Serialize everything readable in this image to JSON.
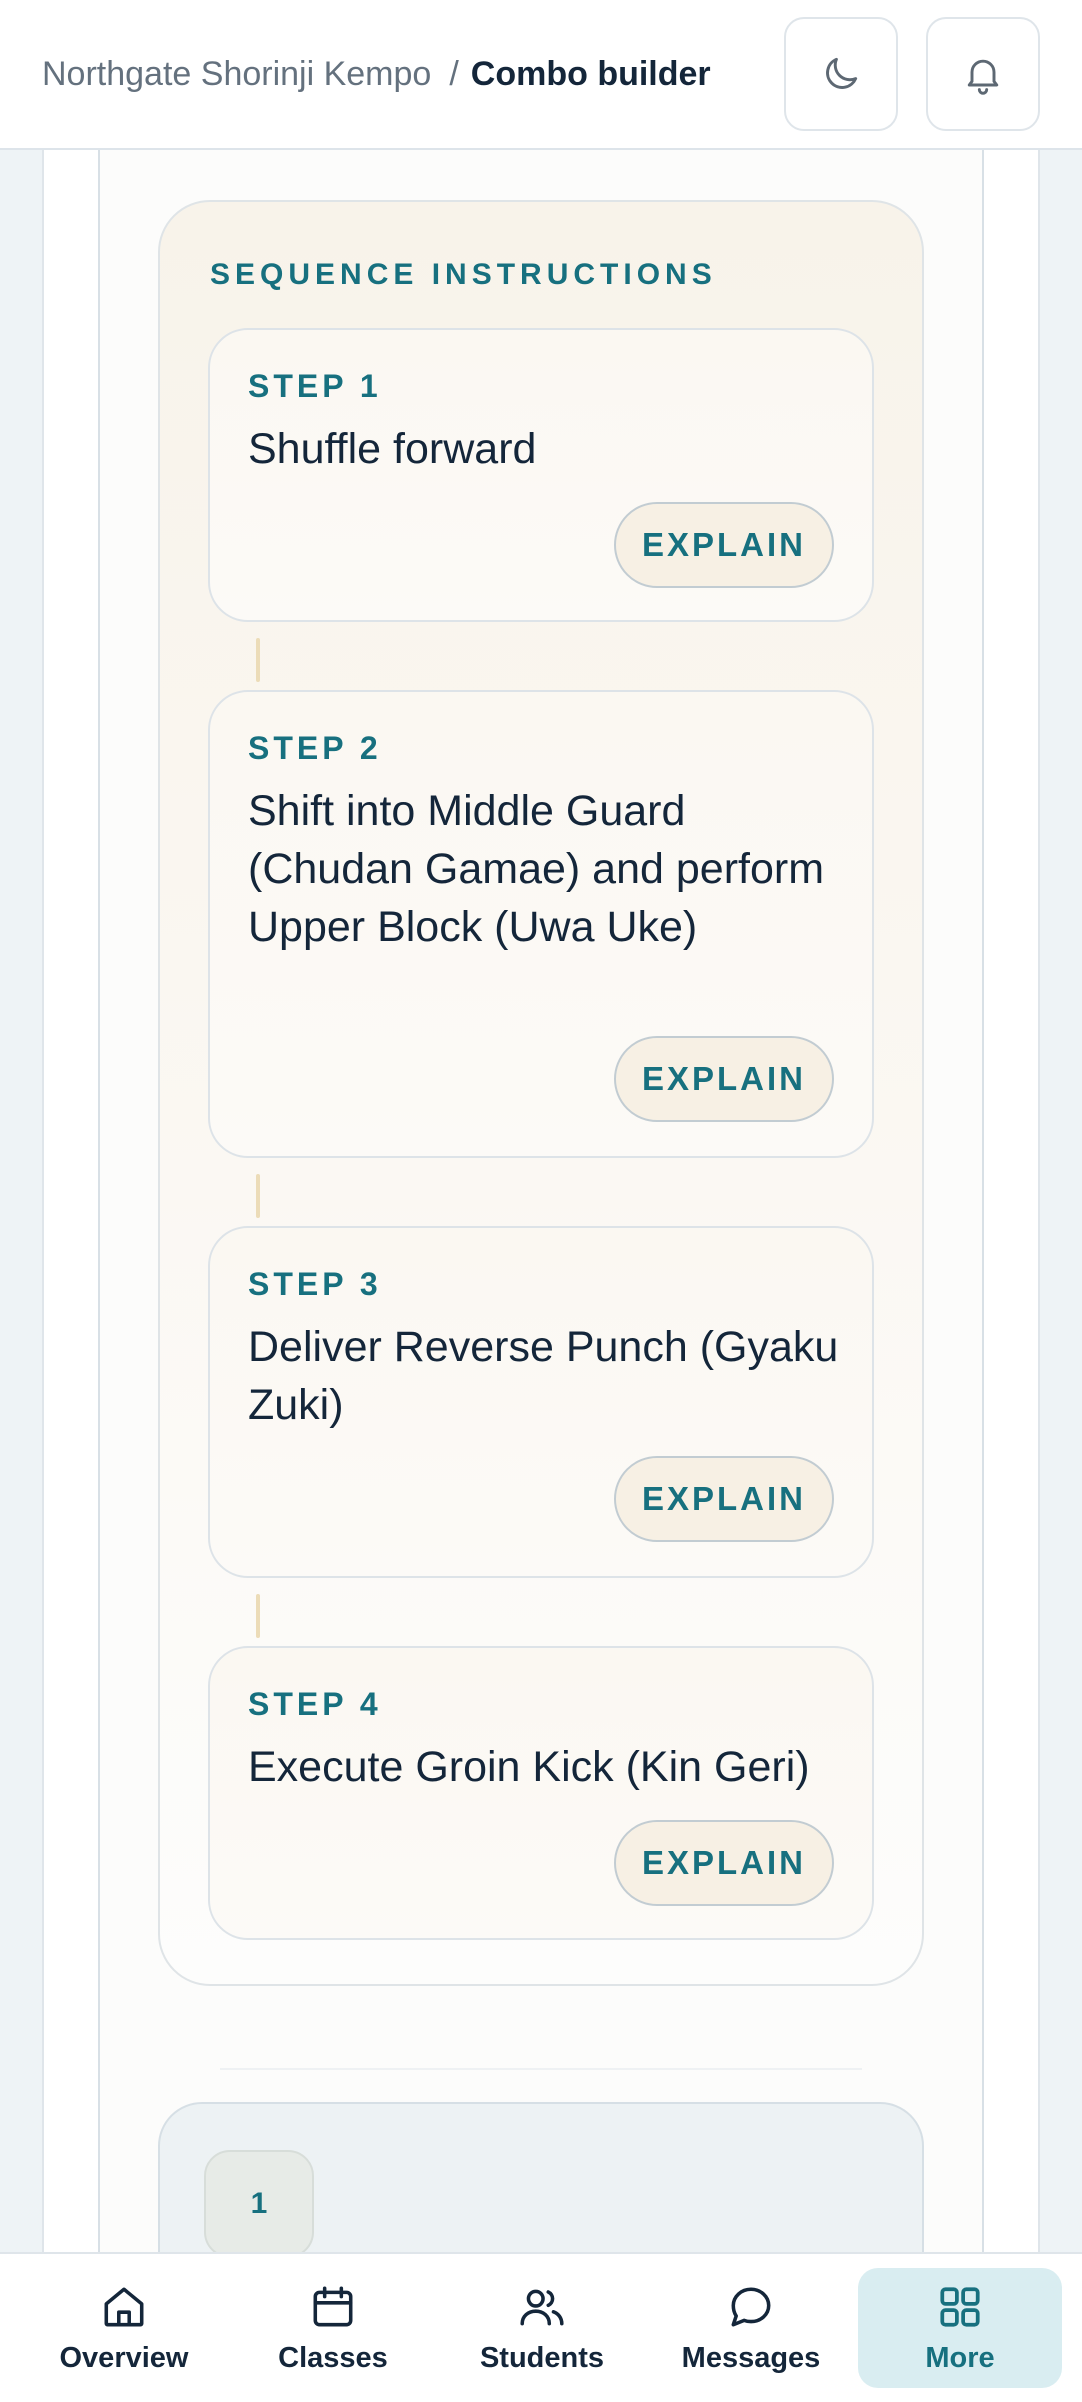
{
  "header": {
    "breadcrumb_org": "Northgate Shorinji Kempo",
    "breadcrumb_sep": "/",
    "breadcrumb_current": "Combo builder",
    "theme_icon": "moon-icon",
    "notifications_icon": "bell-icon"
  },
  "sequence": {
    "title": "SEQUENCE INSTRUCTIONS",
    "steps": [
      {
        "label": "STEP 1",
        "text": "Shuffle forward",
        "button": "EXPLAIN"
      },
      {
        "label": "STEP 2",
        "text": "Shift into Middle Guard (Chudan Gamae) and perform Upper Block (Uwa Uke)",
        "button": "EXPLAIN"
      },
      {
        "label": "STEP 3",
        "text": "Deliver Reverse Punch (Gyaku Zuki)",
        "button": "EXPLAIN"
      },
      {
        "label": "STEP 4",
        "text": "Execute Groin Kick (Kin Geri)",
        "button": "EXPLAIN"
      }
    ]
  },
  "pagination": {
    "current": "1"
  },
  "nav": {
    "items": [
      {
        "label": "Overview",
        "icon": "home-icon"
      },
      {
        "label": "Classes",
        "icon": "calendar-icon"
      },
      {
        "label": "Students",
        "icon": "users-icon"
      },
      {
        "label": "Messages",
        "icon": "chat-icon"
      },
      {
        "label": "More",
        "icon": "grid-icon",
        "active": true
      }
    ]
  },
  "colors": {
    "accent": "#17707f",
    "text": "#14263a",
    "active_nav_bg": "#d9edf1",
    "card_cream": "#f8f3ea"
  }
}
